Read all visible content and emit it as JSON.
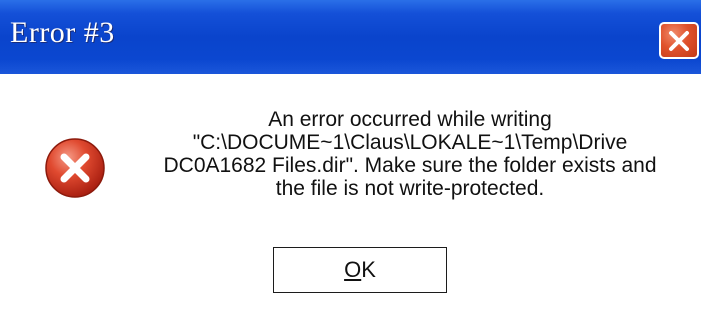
{
  "dialog": {
    "title": "Error #3",
    "icon": "error-icon",
    "message_lines": [
      "An error occurred while writing",
      "\"C:\\DOCUME~1\\Claus\\LOKALE~1\\Temp\\Drive",
      "DC0A1682 Files.dir\". Make sure the folder exists and",
      "the file is not write-protected."
    ],
    "ok_mnemonic": "O",
    "ok_rest": "K",
    "close_icon": "close-icon"
  },
  "colors": {
    "titlebar": "#0b47d0",
    "close_button": "#e0522c",
    "error_red": "#d8351e"
  }
}
